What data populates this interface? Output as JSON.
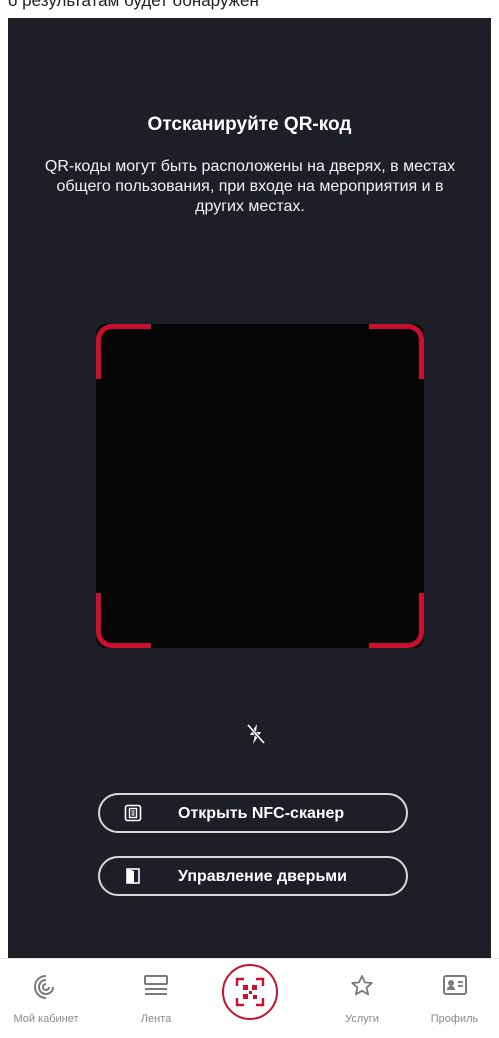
{
  "top_strip_text": "о результатам будет обнаружен",
  "scanner": {
    "title": "Отсканируйте QR-код",
    "description": "QR-коды могут быть расположены на дверях, в местах общего пользования, при входе на мероприятия и в других местах."
  },
  "icons": {
    "flash": "flash-off-icon",
    "nfc": "nfc-icon",
    "doors": "door-icon",
    "scan": "qr-scan-icon"
  },
  "buttons": {
    "nfc_label": "Открыть NFC-сканер",
    "doors_label": "Управление дверьми"
  },
  "tabbar": {
    "items": [
      {
        "label": "Мой кабинет",
        "icon": "cabinet-logo-icon"
      },
      {
        "label": "Лента",
        "icon": "feed-icon"
      },
      {
        "label": "",
        "icon": "qr-scan-icon"
      },
      {
        "label": "Услуги",
        "icon": "star-icon"
      },
      {
        "label": "Профиль",
        "icon": "profile-card-icon"
      }
    ]
  },
  "colors": {
    "background": "#1e1e27",
    "accent": "#c8102e",
    "viewfinder": "#050505"
  }
}
